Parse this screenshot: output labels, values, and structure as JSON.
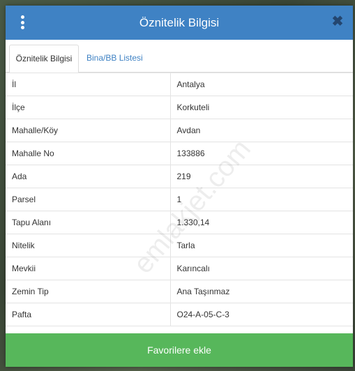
{
  "dialog": {
    "title": "Öznitelik Bilgisi",
    "close_glyph": "✖"
  },
  "tabs": [
    {
      "label": "Öznitelik Bilgisi",
      "active": true
    },
    {
      "label": "Bina/BB Listesi",
      "active": false
    }
  ],
  "rows": [
    {
      "label": "İl",
      "value": "Antalya"
    },
    {
      "label": "İlçe",
      "value": "Korkuteli"
    },
    {
      "label": "Mahalle/Köy",
      "value": "Avdan"
    },
    {
      "label": "Mahalle No",
      "value": "133886"
    },
    {
      "label": "Ada",
      "value": "219"
    },
    {
      "label": "Parsel",
      "value": "1"
    },
    {
      "label": "Tapu Alanı",
      "value": "1.330,14"
    },
    {
      "label": "Nitelik",
      "value": "Tarla"
    },
    {
      "label": "Mevkii",
      "value": "Karıncalı"
    },
    {
      "label": "Zemin Tip",
      "value": "Ana Taşınmaz"
    },
    {
      "label": "Pafta",
      "value": "O24-A-05-C-3"
    }
  ],
  "watermark": "emlakjet.com",
  "footer": {
    "favorite_label": "Favorilere ekle"
  },
  "colors": {
    "header": "#3f82c4",
    "button": "#57b75b",
    "link": "#3f82c4"
  }
}
